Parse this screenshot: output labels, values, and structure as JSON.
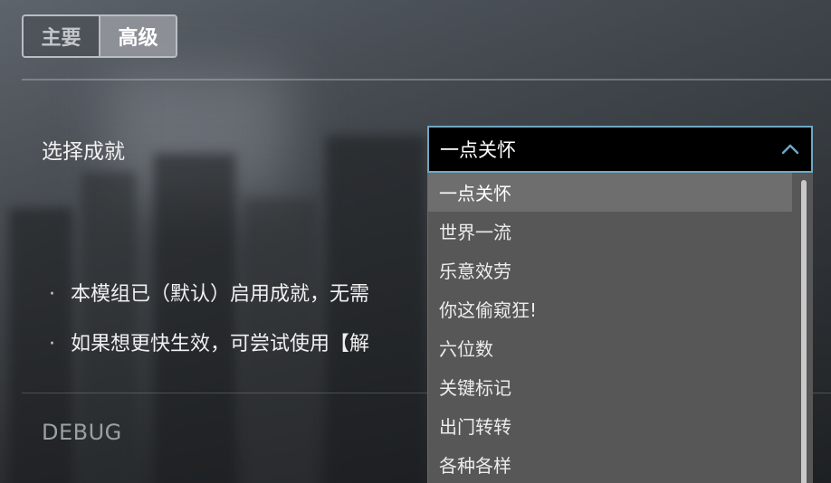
{
  "tabs": [
    {
      "label": "主要",
      "active": false
    },
    {
      "label": "高级",
      "active": true
    }
  ],
  "select_label": "选择成就",
  "select_value": "一点关怀",
  "options": [
    "一点关怀",
    "世界一流",
    "乐意效劳",
    "你这偷窥狂!",
    "六位数",
    "关键标记",
    "出门转转",
    "各种各样"
  ],
  "bullets": [
    "本模组已（默认）启用成就，无需",
    "如果想更快生效，可尝试使用【解"
  ],
  "bullet_marker": "·",
  "debug_label": "DEBUG",
  "icons": {
    "select_toggle": "chevron-up-icon"
  },
  "colors": {
    "select_border": "#6fa7c4",
    "option_selected_bg": "#6e6e6e"
  }
}
